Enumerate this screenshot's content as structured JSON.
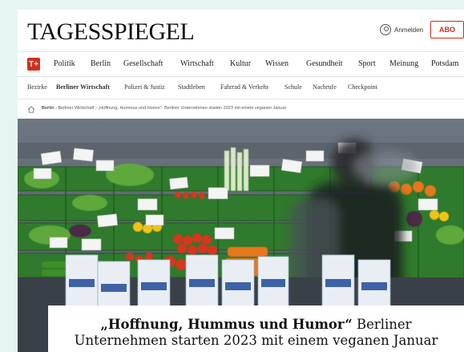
{
  "header": {
    "logo": "TAGESSPIEGEL",
    "login_label": "Anmelden",
    "abo_label": "ABO"
  },
  "mainnav": {
    "brand_icon_label": "T+",
    "items": [
      "Politik",
      "Berlin",
      "Gesellschaft",
      "Wirtschaft",
      "Kultur",
      "Wissen",
      "Gesundheit",
      "Sport",
      "Meinung",
      "Potsdam"
    ]
  },
  "subnav": {
    "items": [
      "Bezirke",
      "Berliner Wirtschaft",
      "Polizei & Justiz",
      "Stadtleben",
      "Fahrrad & Verkehr",
      "Schule",
      "Nachrufe",
      "Checkpoint"
    ],
    "active_index": 1
  },
  "breadcrumb": {
    "items": [
      "Berlin",
      "Berliner Wirtschaft",
      "„Hoffnung, Hummus und Humor“: Berliner Unternehmen starten 2023 mit einem veganen Januar"
    ]
  },
  "article": {
    "headline_bold": "„Hoffnung, Hummus und Humor“",
    "headline_rest_line1": " Berliner",
    "headline_line2": "Unternehmen starten 2023 mit einem veganen Januar"
  },
  "colors": {
    "brand_red": "#d52b1e",
    "page_bg": "#e6f5f2"
  },
  "icons": {
    "login": "user-circle-icon",
    "brand": "tagesspiegel-plus-icon",
    "breadcrumb_home": "home-icon"
  }
}
